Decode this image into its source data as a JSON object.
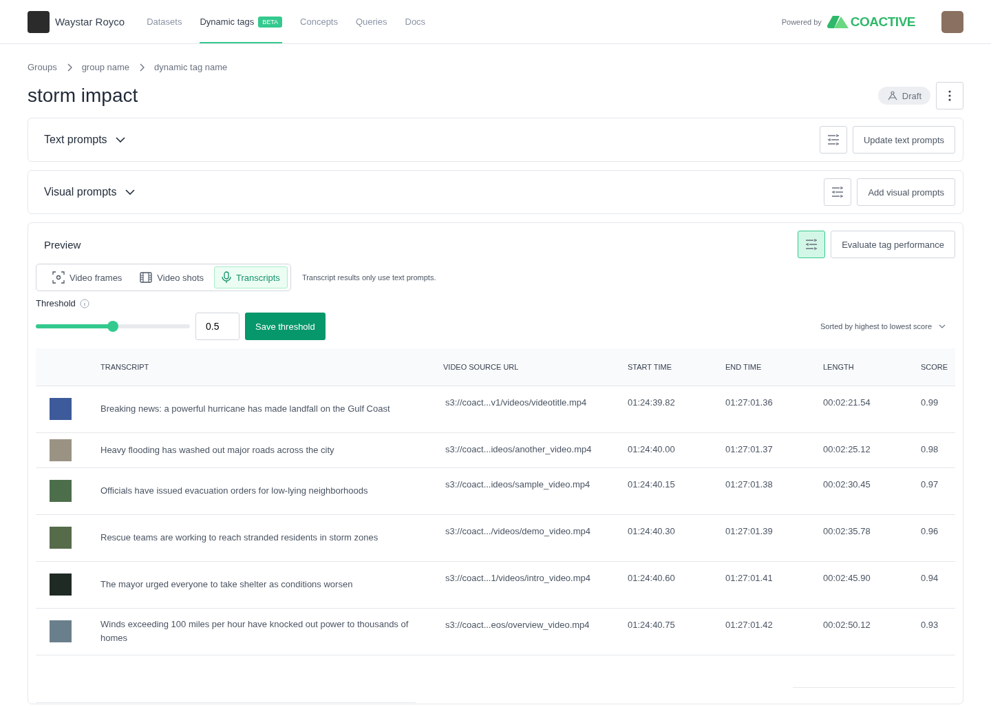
{
  "header": {
    "org_name": "Waystar Royco",
    "nav": [
      {
        "label": "Datasets",
        "selected": false
      },
      {
        "label": "Dynamic tags",
        "selected": true,
        "badge": "BETA"
      },
      {
        "label": "Concepts",
        "selected": false
      },
      {
        "label": "Queries",
        "selected": false
      },
      {
        "label": "Docs",
        "selected": false
      }
    ],
    "powered_by": "Powered by",
    "brand": "COACTIVE"
  },
  "breadcrumbs": [
    "Groups",
    "group name",
    "dynamic tag name"
  ],
  "title": "storm impact",
  "status": "Draft",
  "sections": [
    {
      "title": "Text prompts",
      "button": "Update text prompts",
      "filter_active": false
    },
    {
      "title": "Visual prompts",
      "button": "Add visual prompts",
      "filter_active": false
    }
  ],
  "preview": {
    "title": "Preview",
    "button": "Evaluate tag performance",
    "filter_active": true,
    "modes": [
      {
        "label": "Video frames",
        "kind": "frames",
        "selected": false
      },
      {
        "label": "Video shots",
        "kind": "shots",
        "selected": false
      },
      {
        "label": "Transcripts",
        "kind": "mic",
        "selected": true
      }
    ],
    "mode_note": "Transcript results only use text prompts.",
    "threshold_label": "Threshold",
    "threshold": {
      "level": 0.5
    },
    "threshold_value": "0.5",
    "save_button": "Save threshold",
    "sort": "Sorted by highest to lowest score",
    "columns": [
      "TRANSCRIPT",
      "VIDEO SOURCE URL",
      "START TIME",
      "END TIME",
      "LENGTH",
      "SCORE"
    ],
    "rows": [
      {
        "transcript": "Breaking news: a powerful hurricane has made landfall on the Gulf Coast",
        "url": "s3://coact...v1/videos/videotitle.mp4",
        "start": "01:24:39.82",
        "end": "01:27:01.36",
        "length": "00:02:21.54",
        "score": "0.99"
      },
      {
        "transcript": "Heavy flooding has washed out major roads across the city",
        "url": "s3://coact...ideos/another_video.mp4",
        "start": "01:24:40.00",
        "end": "01:27:01.37",
        "length": "00:02:25.12",
        "score": "0.98"
      },
      {
        "transcript": "Officials have issued evacuation orders for low-lying neighborhoods",
        "url": "s3://coact...ideos/sample_video.mp4",
        "start": "01:24:40.15",
        "end": "01:27:01.38",
        "length": "00:02:30.45",
        "score": "0.97"
      },
      {
        "transcript": "Rescue teams are working to reach stranded residents in storm zones",
        "url": "s3://coact.../videos/demo_video.mp4",
        "start": "01:24:40.30",
        "end": "01:27:01.39",
        "length": "00:02:35.78",
        "score": "0.96"
      },
      {
        "transcript": "The mayor urged everyone to take shelter as conditions worsen",
        "url": "s3://coact...1/videos/intro_video.mp4",
        "start": "01:24:40.60",
        "end": "01:27:01.41",
        "length": "00:02:45.90",
        "score": "0.94"
      },
      {
        "transcript": "Winds exceeding 100 miles per hour have knocked out power to thousands of homes",
        "url": "s3://coact...eos/overview_video.mp4",
        "start": "01:24:40.75",
        "end": "01:27:01.42",
        "length": "00:02:50.12",
        "score": "0.93"
      }
    ]
  }
}
